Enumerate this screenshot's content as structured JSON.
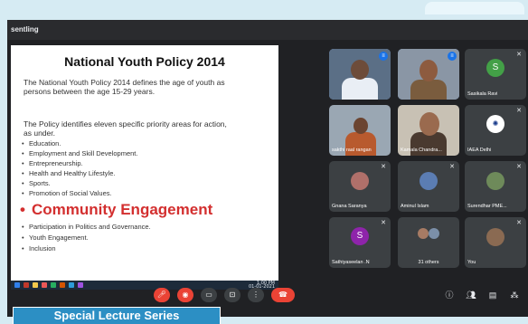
{
  "meeting": {
    "header_text": "sentling"
  },
  "slide": {
    "title": "National Youth Policy 2014",
    "subtitle": "The National Youth Policy 2014 defines the age of youth as persons between the age 15-29 years.",
    "intro": "The Policy identifies eleven specific priority areas for action, as under.",
    "bullets": [
      "Education.",
      "Employment and Skill Development.",
      "Entrepreneurship.",
      "Health and Healthy Lifestyle.",
      "Sports.",
      "Promotion of Social Values."
    ],
    "highlight": "Community Engagement",
    "bullets_after": [
      "Participation in Politics and Governance.",
      "Youth Engagement.",
      "Inclusion"
    ],
    "highlight_color": "#d32f2f"
  },
  "taskbar": {
    "time": "1:00 PM",
    "date": "01-01-2021"
  },
  "participants": [
    {
      "name": "",
      "kind": "video",
      "speaking": true
    },
    {
      "name": "",
      "kind": "video",
      "speaking": true
    },
    {
      "name": "Sasikala Ravi",
      "kind": "letter",
      "letter": "S",
      "color": "#43a047"
    },
    {
      "name": "sakthi raal rangan",
      "kind": "video"
    },
    {
      "name": "Kamala Chandra...",
      "kind": "video"
    },
    {
      "name": "IAEA Delhi",
      "kind": "logo"
    },
    {
      "name": "Gnana Saranya",
      "kind": "photo"
    },
    {
      "name": "Aminul Islam",
      "kind": "photo"
    },
    {
      "name": "Surendhar PME...",
      "kind": "photo"
    },
    {
      "name": "Sathiyaseelan .N",
      "kind": "letter",
      "letter": "S",
      "color": "#8e24aa"
    },
    {
      "name": "31 others",
      "kind": "group"
    },
    {
      "name": "You",
      "kind": "photo"
    }
  ],
  "caption": "Special Lecture Series",
  "icons": [
    "mic-off-icon",
    "camera-off-icon",
    "captions-icon",
    "present-icon",
    "more-icon",
    "end-call-icon",
    "info-icon",
    "people-icon",
    "chat-icon",
    "activities-icon"
  ]
}
